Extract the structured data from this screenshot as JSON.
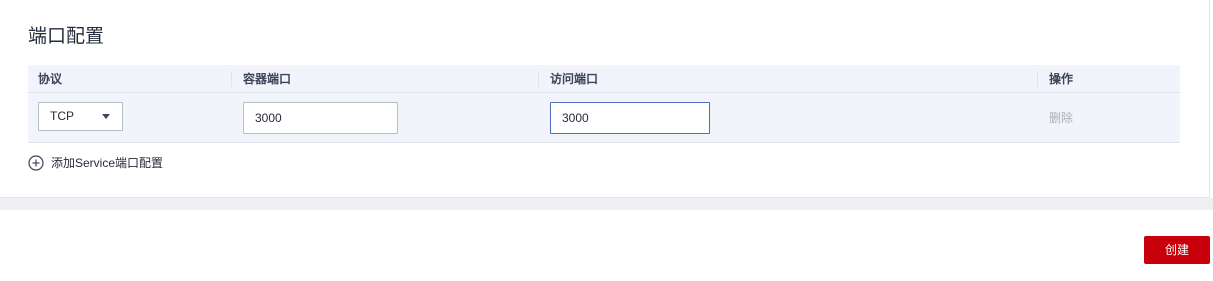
{
  "section": {
    "title": "端口配置"
  },
  "table": {
    "columns": [
      "协议",
      "容器端口",
      "访问端口",
      "操作"
    ],
    "rows": [
      {
        "protocol": "TCP",
        "container_port": "3000",
        "access_port": "3000",
        "action": "删除"
      }
    ]
  },
  "add_link": {
    "label": "添加Service端口配置",
    "icon": "plus-circle-icon"
  },
  "footer": {
    "create_label": "创建"
  },
  "colors": {
    "primary": "#c7000b",
    "table_bg": "#f1f4fa",
    "focus_border": "#526ecc",
    "muted_text": "#adb0b8"
  }
}
